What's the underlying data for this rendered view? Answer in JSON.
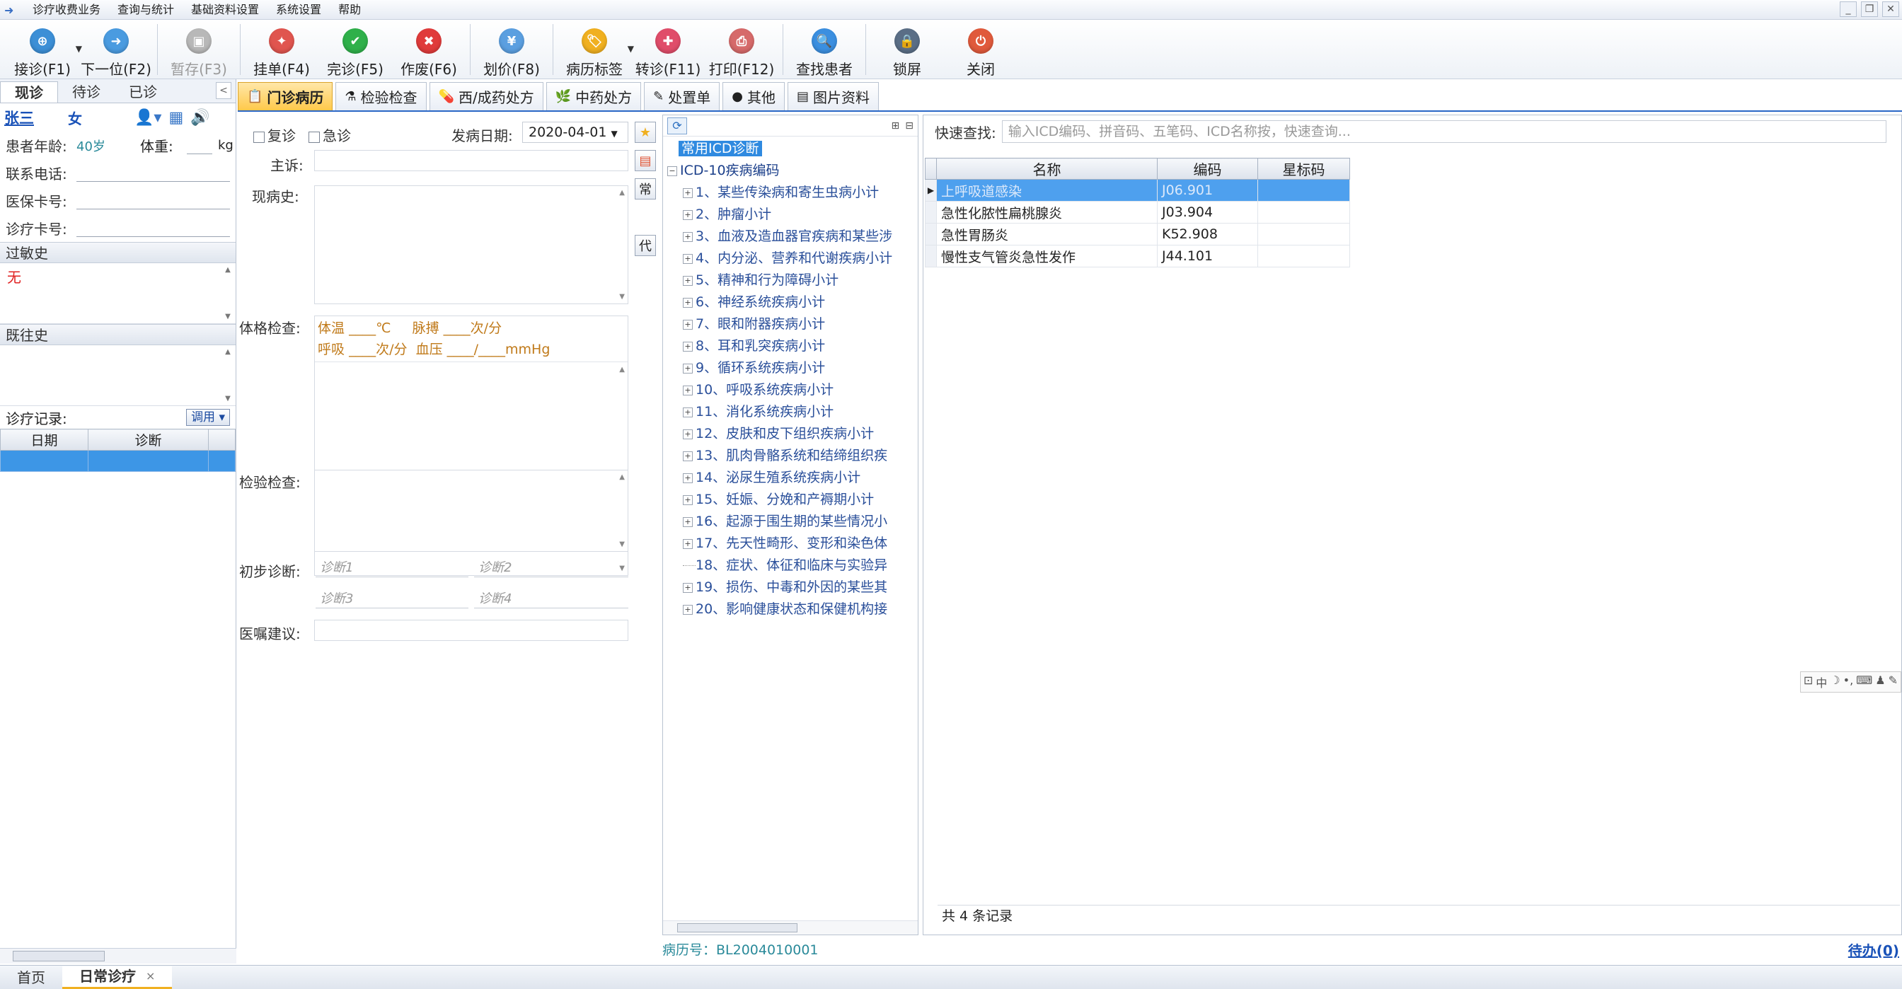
{
  "menu": {
    "items": [
      "诊疗收费业务",
      "查询与统计",
      "基础资料设置",
      "系统设置",
      "帮助"
    ]
  },
  "toolbar": {
    "buttons": [
      {
        "label": "接诊(F1)",
        "icon": "reception-icon",
        "color": "#3c8fd6"
      },
      {
        "label": "下一位(F2)",
        "icon": "next-patient-icon",
        "color": "#4a9be0"
      },
      {
        "label": "暂存(F3)",
        "icon": "save-draft-icon",
        "color": "#b8b8b8"
      },
      {
        "label": "挂单(F4)",
        "icon": "hang-order-icon",
        "color": "#e0554f"
      },
      {
        "label": "完诊(F5)",
        "icon": "complete-icon",
        "color": "#2fb04a"
      },
      {
        "label": "作废(F6)",
        "icon": "void-icon",
        "color": "#e03b3b"
      },
      {
        "label": "划价(F8)",
        "icon": "pricing-icon",
        "color": "#5b9fe0"
      },
      {
        "label": "病历标签",
        "icon": "record-tag-icon",
        "color": "#f0b020"
      },
      {
        "label": "转诊(F11)",
        "icon": "referral-icon",
        "color": "#e04d6a"
      },
      {
        "label": "打印(F12)",
        "icon": "print-icon",
        "color": "#d66a6a"
      },
      {
        "label": "查找患者",
        "icon": "find-patient-icon",
        "color": "#3b8fe0"
      },
      {
        "label": "锁屏",
        "icon": "lock-screen-icon",
        "color": "#5a6e86"
      },
      {
        "label": "关闭",
        "icon": "close-icon",
        "color": "#e05a3c"
      }
    ]
  },
  "left": {
    "tabs": [
      "现诊",
      "待诊",
      "已诊"
    ],
    "patient": {
      "name": "张三",
      "sex": "女"
    },
    "fields": {
      "age_label": "患者年龄:",
      "age_value": "40岁",
      "weight_label": "体重:",
      "weight_unit": "kg",
      "phone_label": "联系电话:",
      "insurance_label": "医保卡号:",
      "card_label": "诊疗卡号:"
    },
    "allergy_label": "过敏史",
    "allergy_value": "无",
    "history_label": "既往史",
    "records_label": "诊疗记录:",
    "records_button": "调用",
    "records_columns": [
      "日期",
      "诊断"
    ]
  },
  "center_tabs": [
    {
      "label": "门诊病历",
      "icon": "medical-record-icon"
    },
    {
      "label": "检验检查",
      "icon": "lab-test-icon"
    },
    {
      "label": "西/成药处方",
      "icon": "pill-icon"
    },
    {
      "label": "中药处方",
      "icon": "herb-icon"
    },
    {
      "label": "处置单",
      "icon": "treatment-icon"
    },
    {
      "label": "其他",
      "icon": "other-icon"
    },
    {
      "label": "图片资料",
      "icon": "image-icon"
    }
  ],
  "form": {
    "revisit": "复诊",
    "emergency": "急诊",
    "onset_label": "发病日期:",
    "onset_date": "2020-04-01",
    "complaint": "主诉:",
    "present_illness": "现病史:",
    "physical_exam": "体格检查:",
    "vitals": {
      "temp": "体温",
      "temp_unit": "℃",
      "pulse": "脉搏",
      "pulse_unit": "次/分",
      "resp": "呼吸",
      "resp_unit": "次/分",
      "bp": "血压",
      "bp_sep": "/",
      "bp_unit": "mmHg",
      "blank": "____"
    },
    "lab_exam": "检验检查:",
    "prelim_label": "初步诊断:",
    "diag1": "诊断1",
    "diag2": "诊断2",
    "diag3": "诊断3",
    "diag4": "诊断4",
    "advice": "医嘱建议:"
  },
  "side_buttons": [
    "常",
    "代"
  ],
  "tree": {
    "common": "常用ICD诊断",
    "root": "ICD-10疾病编码",
    "chapters": [
      "1、某些传染病和寄生虫病小计",
      "2、肿瘤小计",
      "3、血液及造血器官疾病和某些涉",
      "4、内分泌、营养和代谢疾病小计",
      "5、精神和行为障碍小计",
      "6、神经系统疾病小计",
      "7、眼和附器疾病小计",
      "8、耳和乳突疾病小计",
      "9、循环系统疾病小计",
      "10、呼吸系统疾病小计",
      "11、消化系统疾病小计",
      "12、皮肤和皮下组织疾病小计",
      "13、肌肉骨骼系统和结缔组织疾",
      "14、泌尿生殖系统疾病小计",
      "15、妊娠、分娩和产褥期小计",
      "16、起源于围生期的某些情况小",
      "17、先天性畸形、变形和染色体",
      "18、症状、体征和临床与实验异",
      "19、损伤、中毒和外因的某些其",
      "20、影响健康状态和保健机构接"
    ]
  },
  "search": {
    "label": "快速查找:",
    "placeholder": "输入ICD编码、拼音码、五笔码、ICD名称按，快速查询..."
  },
  "grid": {
    "columns": [
      "名称",
      "编码",
      "星标码"
    ],
    "rows": [
      {
        "name": "上呼吸道感染",
        "code": "J06.901",
        "star": ""
      },
      {
        "name": "急性化脓性扁桃腺炎",
        "code": "J03.904",
        "star": ""
      },
      {
        "name": "急性胃肠炎",
        "code": "K52.908",
        "star": ""
      },
      {
        "name": "慢性支气管炎急性发作",
        "code": "J44.101",
        "star": ""
      }
    ],
    "count": "共 4 条记录"
  },
  "ime": [
    "中",
    "☽",
    "•,",
    "⌨",
    "♟",
    "✎"
  ],
  "record_no": "病历号：BL2004010001",
  "todo": "待办(0)",
  "bottom_tabs": {
    "home": "首页",
    "daily": "日常诊疗",
    "close": "×"
  }
}
